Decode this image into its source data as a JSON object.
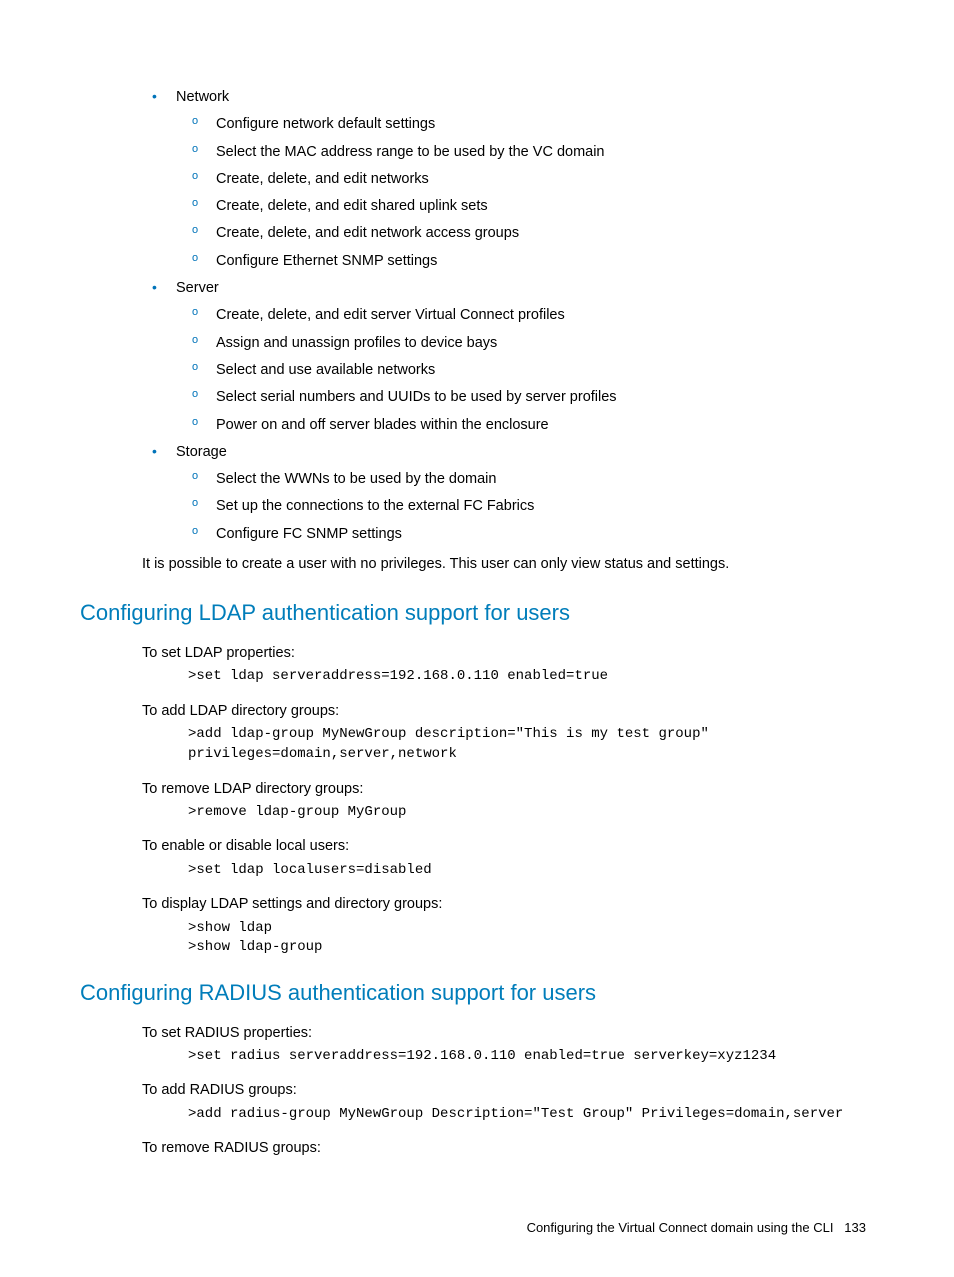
{
  "bullets": {
    "network": {
      "title": "Network",
      "items": [
        "Configure network default settings",
        "Select the MAC address range to be used by the VC domain",
        "Create, delete, and edit networks",
        "Create, delete, and edit shared uplink sets",
        "Create, delete, and edit network access groups",
        "Configure Ethernet SNMP settings"
      ]
    },
    "server": {
      "title": "Server",
      "items": [
        "Create, delete, and edit server Virtual Connect profiles",
        "Assign and unassign profiles to device bays",
        "Select and use available networks",
        "Select serial numbers and UUIDs to be used by server profiles",
        "Power on and off server blades within the enclosure"
      ]
    },
    "storage": {
      "title": "Storage",
      "items": [
        "Select the WWNs to be used by the domain",
        "Set up the connections to the external FC Fabrics",
        "Configure FC SNMP settings"
      ]
    }
  },
  "note": "It is possible to create a user with no privileges. This user can only view status and settings.",
  "ldap": {
    "heading": "Configuring LDAP authentication support for users",
    "set_label": "To set LDAP properties:",
    "set_code": ">set ldap serveraddress=192.168.0.110 enabled=true",
    "add_label": "To add LDAP directory groups:",
    "add_code": ">add ldap-group MyNewGroup description=\"This is my test group\" privileges=domain,server,network",
    "remove_label": "To remove LDAP directory groups:",
    "remove_code": ">remove ldap-group MyGroup",
    "local_label": "To enable or disable local users:",
    "local_code": ">set ldap localusers=disabled",
    "show_label": "To display LDAP settings and directory groups:",
    "show_code": ">show ldap\n>show ldap-group"
  },
  "radius": {
    "heading": "Configuring RADIUS authentication support for users",
    "set_label": "To set RADIUS properties:",
    "set_code": ">set radius serveraddress=192.168.0.110 enabled=true serverkey=xyz1234",
    "add_label": "To add RADIUS groups:",
    "add_code": ">add radius-group MyNewGroup Description=\"Test Group\" Privileges=domain,server",
    "remove_label": "To remove RADIUS groups:"
  },
  "footer": {
    "text": "Configuring the Virtual Connect domain using the CLI",
    "page": "133"
  }
}
